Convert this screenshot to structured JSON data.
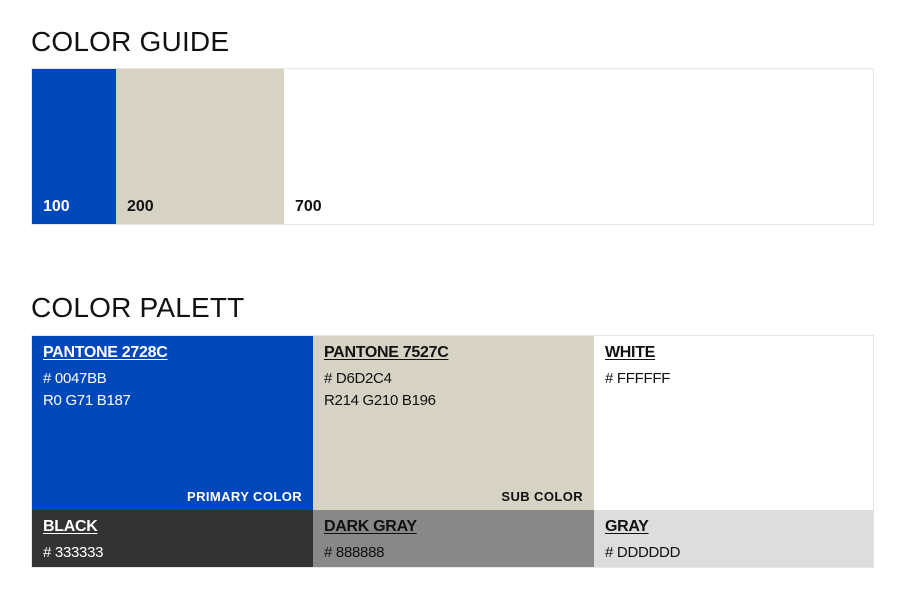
{
  "guide": {
    "title": "COLOR GUIDE",
    "swatches": [
      {
        "label": "100",
        "color": "#0047BB",
        "text_color": "#ffffff",
        "flex": 84
      },
      {
        "label": "200",
        "color": "#D6D2C4",
        "text_color": "#111111",
        "flex": 168
      },
      {
        "label": "700",
        "color": "#FFFFFF",
        "text_color": "#111111",
        "flex": 589
      }
    ]
  },
  "palette": {
    "title": "COLOR PALETT",
    "colors": [
      {
        "name": "PANTONE 2728C",
        "hex": "# 0047BB",
        "rgb": "R0 G71 B187",
        "role": "PRIMARY COLOR",
        "color": "#0047BB"
      },
      {
        "name": "PANTONE 7527C",
        "hex": "# D6D2C4",
        "rgb": "R214 G210 B196",
        "role": "SUB COLOR",
        "color": "#D6D2C4"
      },
      {
        "name": "WHITE",
        "hex": "# FFFFFF",
        "color": "#FFFFFF"
      },
      {
        "name": "BLACK",
        "hex": "# 333333",
        "color": "#333333"
      },
      {
        "name": "DARK GRAY",
        "hex": "# 888888",
        "color": "#888888"
      },
      {
        "name": "GRAY",
        "hex": "# DDDDDD",
        "color": "#DDDDDD"
      }
    ]
  }
}
